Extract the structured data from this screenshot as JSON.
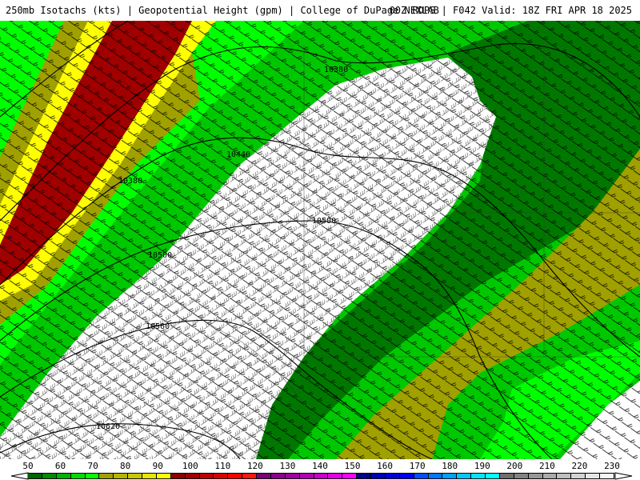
{
  "header": {
    "title_left": "250mb Isotachs (kts) | Geopotential Height (gpm) | College of DuPage NEXLAB",
    "title_right": "00Z RDPS | F042 Valid: 18Z FRI APR 18 2025"
  },
  "map": {
    "contour_labels": [
      "10380",
      "10440",
      "10380",
      "10500",
      "10500",
      "10560",
      "10620"
    ],
    "fill_colors": {
      "light_green": "#00ff00",
      "mid_green": "#00c800",
      "dark_green": "#007800",
      "olive": "#a0a000",
      "yellow": "#ffff00",
      "dark_red": "#a00000",
      "white": "#ffffff"
    }
  },
  "colorbar": {
    "tick_labels": [
      "50",
      "60",
      "70",
      "80",
      "90",
      "100",
      "110",
      "120",
      "130",
      "140",
      "150",
      "160",
      "170",
      "180",
      "190",
      "200",
      "210",
      "220",
      "230"
    ],
    "swatch_colors": [
      "#006400",
      "#008c00",
      "#00b400",
      "#00dc00",
      "#00ff00",
      "#a0a000",
      "#b4b400",
      "#c8c800",
      "#e6e600",
      "#ffff00",
      "#8c0000",
      "#a00000",
      "#c00000",
      "#dc0000",
      "#ff0000",
      "#ff1414",
      "#7a007a",
      "#8c008c",
      "#a000a0",
      "#b400b4",
      "#c800c8",
      "#e600e6",
      "#ff00ff",
      "#00008c",
      "#0000b4",
      "#0000dc",
      "#0000ff",
      "#0050ff",
      "#0078ff",
      "#00a0ff",
      "#00c8ff",
      "#00e6ff",
      "#00ffff",
      "#6e6e6e",
      "#828282",
      "#969696",
      "#aaaaaa",
      "#bebebe",
      "#d2d2d2",
      "#e6e6e6",
      "#f5f5f5"
    ]
  }
}
